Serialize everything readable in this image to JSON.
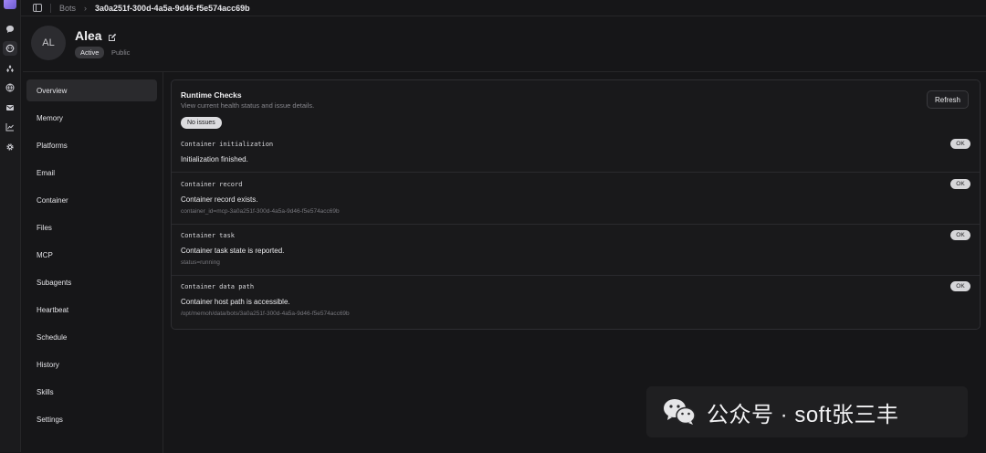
{
  "breadcrumb": {
    "root": "Bots",
    "current": "3a0a251f-300d-4a5a-9d46-f5e574acc69b"
  },
  "rail": {
    "icons": [
      "chat-icon",
      "bot-icon",
      "skills-icon",
      "globe-icon",
      "mail-icon",
      "chart-icon",
      "gear-icon"
    ],
    "active": "bot-icon"
  },
  "bot": {
    "avatar_initials": "AL",
    "name": "Alea",
    "status": "Active",
    "visibility": "Public"
  },
  "nav": {
    "items": [
      "Overview",
      "Memory",
      "Platforms",
      "Email",
      "Container",
      "Files",
      "MCP",
      "Subagents",
      "Heartbeat",
      "Schedule",
      "History",
      "Skills",
      "Settings"
    ],
    "active": "Overview"
  },
  "runtime": {
    "title": "Runtime Checks",
    "description": "View current health status and issue details.",
    "refresh_label": "Refresh",
    "summary": "No issues",
    "checks": [
      {
        "name": "Container initialization",
        "message": "Initialization finished.",
        "detail": "",
        "status": "OK"
      },
      {
        "name": "Container record",
        "message": "Container record exists.",
        "detail": "container_id=mcp-3a0a251f-300d-4a5a-9d46-f5e574acc69b",
        "status": "OK"
      },
      {
        "name": "Container task",
        "message": "Container task state is reported.",
        "detail": "status=running",
        "status": "OK"
      },
      {
        "name": "Container data path",
        "message": "Container host path is accessible.",
        "detail": "/opt/memoh/data/bots/3a0a251f-300d-4a5a-9d46-f5e574acc69b",
        "status": "OK"
      }
    ]
  },
  "watermark": {
    "text": "公众号 · soft张三丰"
  }
}
